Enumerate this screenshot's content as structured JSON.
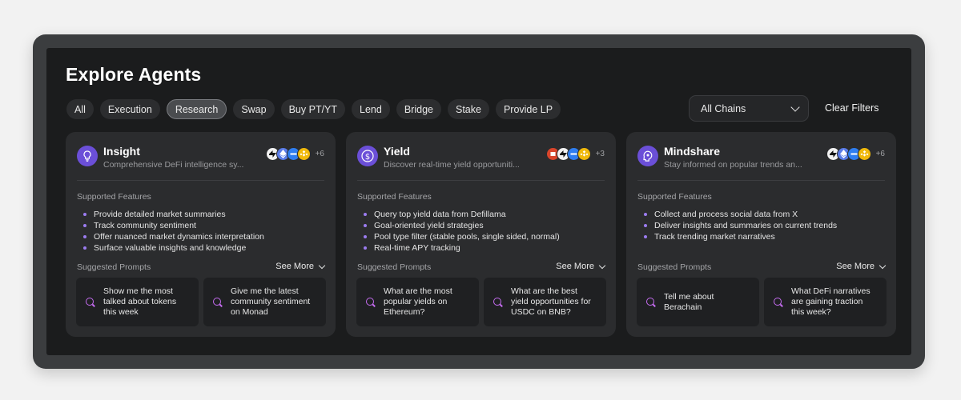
{
  "page": {
    "title": "Explore Agents",
    "filters": [
      "All",
      "Execution",
      "Research",
      "Swap",
      "Buy PT/YT",
      "Lend",
      "Bridge",
      "Stake",
      "Provide LP"
    ],
    "active_filter": "Research",
    "chain_select": "All Chains",
    "clear_filters": "Clear Filters"
  },
  "colors": {
    "accent": "#6b4fd8",
    "prompt_icon": "#c56cf0"
  },
  "cards": [
    {
      "name": "Insight",
      "icon": "lightbulb-icon",
      "description": "Comprehensive DeFi intelligence sy...",
      "chain_icons": [
        "zksync-icon",
        "ethereum-icon",
        "blue-chain-icon",
        "bnb-icon"
      ],
      "more_chains": "+6",
      "features_label": "Supported Features",
      "features": [
        "Provide detailed market summaries",
        "Track community sentiment",
        "Offer nuanced market dynamics interpretation",
        "Surface valuable insights and knowledge"
      ],
      "prompts_label": "Suggested Prompts",
      "see_more": "See More",
      "prompts": [
        "Show me the most talked about tokens this week",
        "Give me the latest community sentiment on Monad"
      ]
    },
    {
      "name": "Yield",
      "icon": "dollar-icon",
      "description": "Discover real-time yield opportuniti...",
      "chain_icons": [
        "red-chain-icon",
        "zksync-icon",
        "blue-chain-icon",
        "bnb-icon"
      ],
      "more_chains": "+3",
      "features_label": "Supported Features",
      "features": [
        "Query top yield data from Defillama",
        "Goal-oriented yield strategies",
        "Pool type filter (stable pools, single sided, normal)",
        "Real-time APY tracking"
      ],
      "prompts_label": "Suggested Prompts",
      "see_more": "See More",
      "prompts": [
        "What are the most popular yields on Ethereum?",
        "What are the best yield opportunities for USDC on BNB?"
      ]
    },
    {
      "name": "Mindshare",
      "icon": "brain-icon",
      "description": "Stay informed on popular trends an...",
      "chain_icons": [
        "zksync-icon",
        "ethereum-icon",
        "blue-chain-icon",
        "bnb-icon"
      ],
      "more_chains": "+6",
      "features_label": "Supported Features",
      "features": [
        "Collect and process social data from X",
        "Deliver insights and summaries on current trends",
        "Track trending market narratives"
      ],
      "prompts_label": "Suggested Prompts",
      "see_more": "See More",
      "prompts": [
        "Tell me about Berachain",
        "What DeFi narratives are gaining traction this week?"
      ]
    }
  ]
}
